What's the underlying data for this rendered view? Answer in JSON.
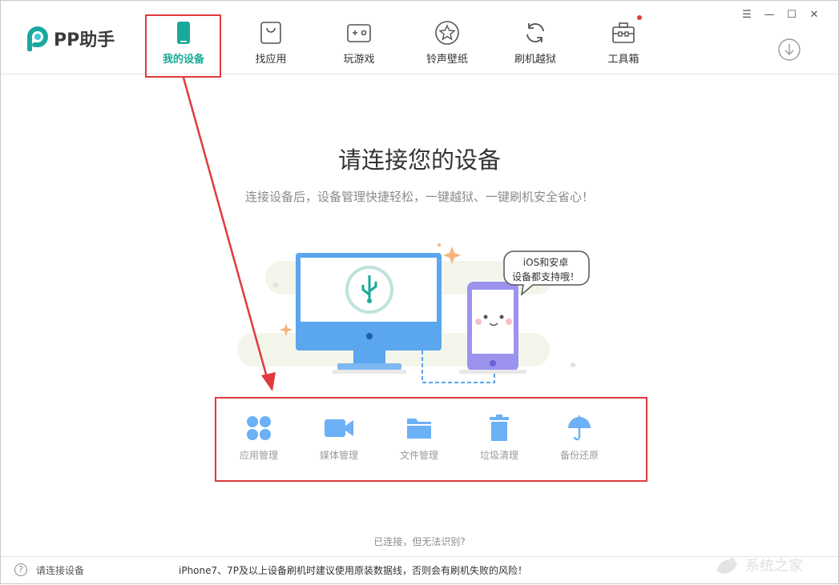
{
  "app": {
    "logo_text": "PP助手"
  },
  "nav": {
    "tabs": [
      {
        "label": "我的设备",
        "icon": "device-icon",
        "active": true
      },
      {
        "label": "找应用",
        "icon": "app-bag-icon",
        "active": false
      },
      {
        "label": "玩游戏",
        "icon": "gamepad-icon",
        "active": false
      },
      {
        "label": "铃声壁纸",
        "icon": "star-icon",
        "active": false
      },
      {
        "label": "刷机越狱",
        "icon": "refresh-icon",
        "active": false
      },
      {
        "label": "工具箱",
        "icon": "toolbox-icon",
        "active": false,
        "badge": true
      }
    ]
  },
  "window_controls": {
    "menu": "☰",
    "minimize": "—",
    "maximize": "☐",
    "close": "✕"
  },
  "main": {
    "title": "请连接您的设备",
    "subtitle": "连接设备后，设备管理快捷轻松，一键越狱、一键刷机安全省心！",
    "bubble_line1": "iOS和安卓",
    "bubble_line2": "设备都支持哦！",
    "features": [
      {
        "label": "应用管理",
        "icon": "apps-grid-icon"
      },
      {
        "label": "媒体管理",
        "icon": "video-camera-icon"
      },
      {
        "label": "文件管理",
        "icon": "folder-icon"
      },
      {
        "label": "垃圾清理",
        "icon": "trash-icon"
      },
      {
        "label": "备份还原",
        "icon": "umbrella-icon"
      }
    ],
    "help_link": "已连接，但无法识别?"
  },
  "status": {
    "help_icon": "?",
    "connection": "请连接设备",
    "notice": "iPhone7、7P及以上设备刷机时建议使用原装数据线，否则会有刷机失败的风险！"
  },
  "watermark": {
    "text": "系统之家"
  },
  "colors": {
    "accent": "#19a99a",
    "highlight": "#e03a3e",
    "feature_blue": "#6cb0f5"
  }
}
